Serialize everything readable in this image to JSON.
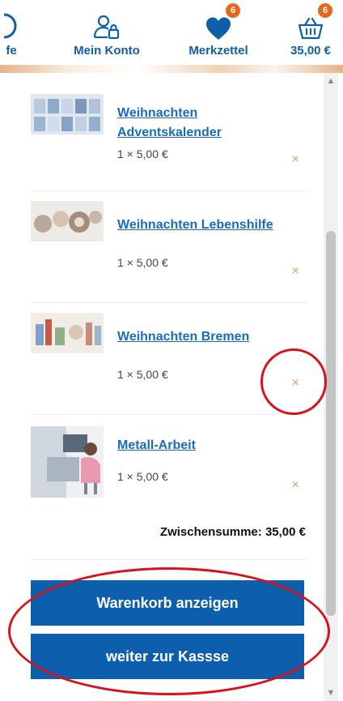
{
  "header": {
    "left_partial_label": "fe",
    "account_label": "Mein Konto",
    "wishlist_label": "Merkzettel",
    "wishlist_count": "6",
    "cart_total_label": "35,00 €",
    "cart_count": "6"
  },
  "cart": {
    "items": [
      {
        "title": "Weihnachten Adventskalender",
        "qty": "1 × 5,00 €",
        "remove": "×"
      },
      {
        "title": "Weihnachten Lebenshilfe",
        "qty": "1 × 5,00 €",
        "remove": "×"
      },
      {
        "title": "Weihnachten Bremen",
        "qty": "1 × 5,00 €",
        "remove": "×"
      },
      {
        "title": "Metall-Arbeit",
        "qty": "1 × 5,00 €",
        "remove": "×"
      }
    ],
    "subtotal": "Zwischensumme: 35,00 €",
    "view_cart_label": "Warenkorb anzeigen",
    "checkout_label": "weiter zur Kassse"
  },
  "colors": {
    "primary": "#0e5fab",
    "link": "#1b6cb8",
    "badge": "#e8651c",
    "remove": "#e59a62",
    "annotation": "#d8121b"
  },
  "icons": {
    "account": "user-lock-icon",
    "wishlist": "heart-icon",
    "cart": "basket-icon"
  }
}
